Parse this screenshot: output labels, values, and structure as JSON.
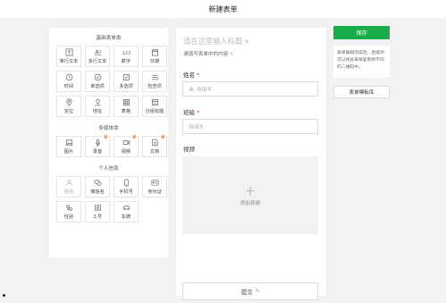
{
  "header": {
    "title": "新建表单"
  },
  "sidebar": {
    "basic": {
      "title": "基础表单类",
      "items": [
        {
          "label": "单行文本",
          "icon": "text-t-icon"
        },
        {
          "label": "多行文本",
          "icon": "text-multiline-icon"
        },
        {
          "label": "数字",
          "icon": "number-icon"
        },
        {
          "label": "日期",
          "icon": "calendar-icon"
        },
        {
          "label": "时间",
          "icon": "clock-icon"
        },
        {
          "label": "单选项",
          "icon": "radio-icon"
        },
        {
          "label": "多选项",
          "icon": "checkbox-icon"
        },
        {
          "label": "检查项",
          "icon": "checklist-icon"
        },
        {
          "label": "定位",
          "icon": "location-icon"
        },
        {
          "label": "地址",
          "icon": "address-icon"
        },
        {
          "label": "表格",
          "icon": "table-icon"
        },
        {
          "label": "分组标题",
          "icon": "group-title-icon"
        }
      ]
    },
    "media": {
      "title": "多媒体类",
      "items": [
        {
          "label": "图片",
          "icon": "image-icon",
          "premium": false
        },
        {
          "label": "录音",
          "icon": "microphone-icon",
          "premium": true
        },
        {
          "label": "视频",
          "icon": "video-icon",
          "premium": true
        },
        {
          "label": "文档",
          "icon": "document-icon",
          "premium": true
        }
      ]
    },
    "personal": {
      "title": "个人信息",
      "items": [
        {
          "label": "姓名",
          "icon": "person-icon",
          "disabled": true
        },
        {
          "label": "微信名",
          "icon": "wechat-icon",
          "disabled": false
        },
        {
          "label": "手机号",
          "icon": "phone-icon",
          "disabled": false
        },
        {
          "label": "身份证",
          "icon": "id-card-icon",
          "disabled": false
        },
        {
          "label": "性别",
          "icon": "gender-icon",
          "disabled": false
        },
        {
          "label": "工号",
          "icon": "badge-icon",
          "disabled": false
        },
        {
          "label": "车牌",
          "icon": "car-icon",
          "disabled": false
        }
      ]
    }
  },
  "form": {
    "title_placeholder": "请在这里输入标题",
    "desc_placeholder": "请填写表单中的内容",
    "fields": [
      {
        "label": "姓名",
        "required": "*",
        "placeholder": "待填写"
      },
      {
        "label": "班级",
        "required": "*",
        "placeholder": "待填写"
      }
    ],
    "video": {
      "label": "视频",
      "upload_text": "添加视频",
      "plus": "+"
    },
    "submit_label": "提交"
  },
  "right": {
    "save_label": "保存",
    "tip_text": "表单编辑完成后，后续你可以将此表单复制到不同的二维码中。",
    "template_label": "表单模板库"
  },
  "colors": {
    "accent": "#1aad4b",
    "required": "#e4393c",
    "premium": "#ff6a00"
  }
}
